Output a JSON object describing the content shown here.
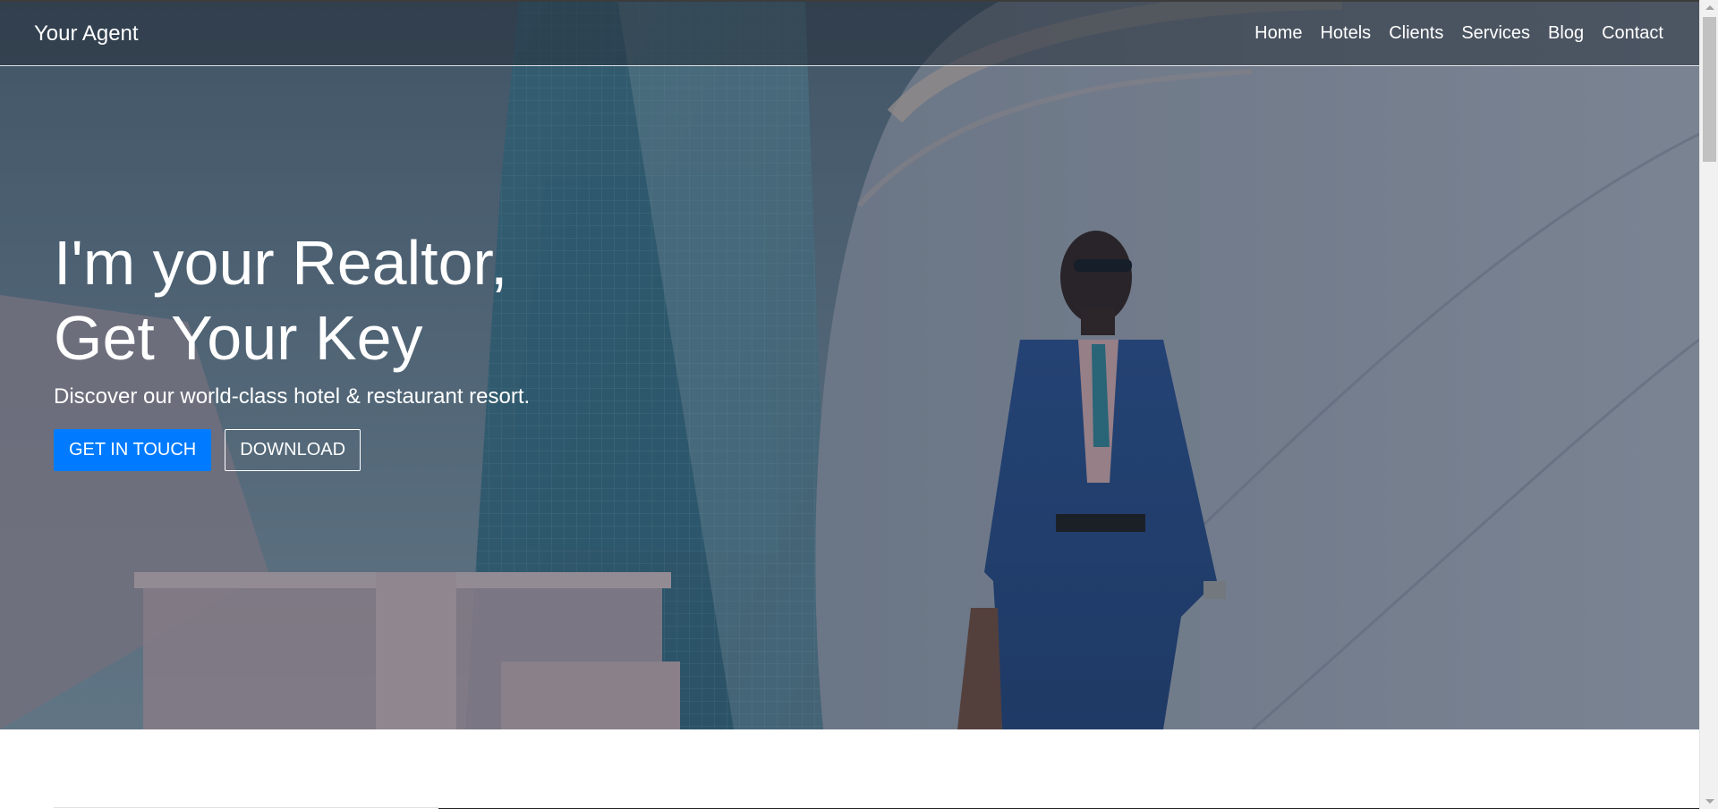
{
  "navbar": {
    "brand": "Your Agent",
    "links": [
      "Home",
      "Hotels",
      "Clients",
      "Services",
      "Blog",
      "Contact"
    ]
  },
  "hero": {
    "title_line1": "I'm your Realtor,",
    "title_line2": "Get Your Key",
    "subtitle": "Discover our world-class hotel & restaurant resort.",
    "primary_button": "GET IN TOUCH",
    "secondary_button": "DOWNLOAD"
  },
  "colors": {
    "accent": "#007bff",
    "navbar_bg": "rgba(38,48,58,0.55)",
    "text": "#ffffff"
  },
  "icons": {
    "scroll_up": "triangle-up-icon",
    "scroll_down": "triangle-down-icon"
  }
}
